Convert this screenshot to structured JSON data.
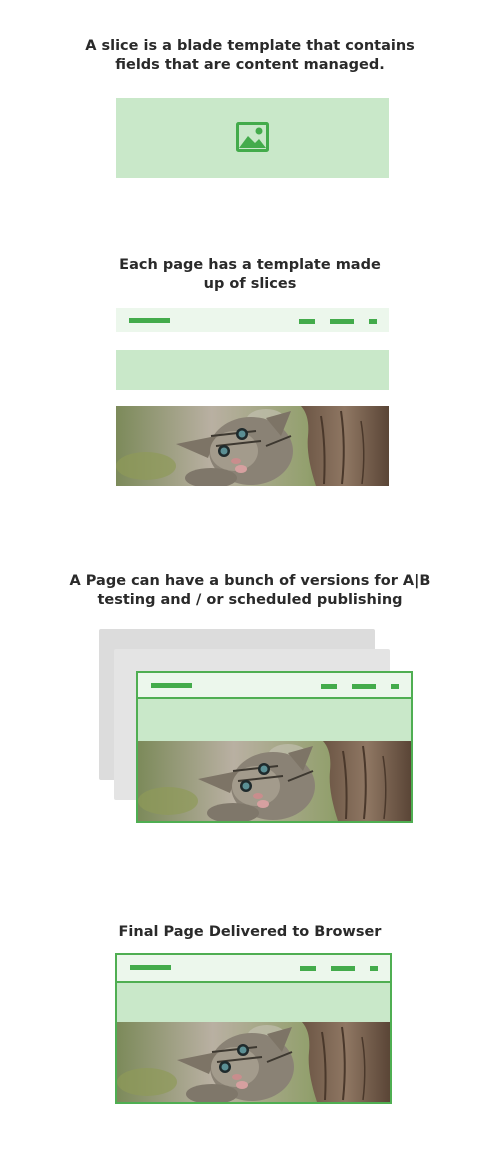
{
  "sections": [
    {
      "caption_lines": [
        "A slice is a blade template that contains",
        "fields that are content managed."
      ]
    },
    {
      "caption_lines": [
        "Each page has a template made",
        "up of slices"
      ]
    },
    {
      "caption_lines": [
        "A Page can have a bunch of versions for A|B",
        "testing and / or scheduled publishing"
      ]
    },
    {
      "caption_lines": [
        "Final Page Delivered to Browser"
      ]
    }
  ],
  "icons": {
    "placeholder_image": "image-placeholder-icon",
    "photo": "kitten-photo"
  },
  "colors": {
    "accent": "#43ab4b",
    "slice_fill": "#c9e8c9",
    "header_fill": "#ecf7ec",
    "ghost": "#dcdcdc"
  }
}
